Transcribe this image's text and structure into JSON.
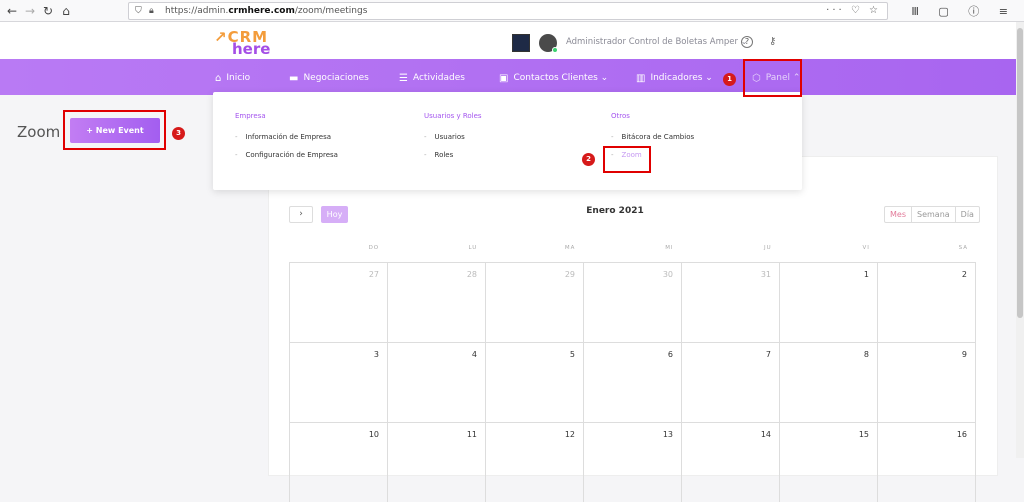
{
  "browser": {
    "url_prefix": "https://admin.",
    "url_domain": "crmhere.com",
    "url_path": "/zoom/meetings",
    "back_glyph": "←",
    "forward_glyph": "→",
    "reload_glyph": "↻",
    "home_glyph": "⌂",
    "url_right_glyphs": "··· ♡ ☆",
    "toolbar_glyphs": "Ⅲ ▢ ⓘ ≡"
  },
  "brand": {
    "logo_line1": "↗CRM",
    "logo_line2": "here",
    "orange": "#f39c3b",
    "purple": "#a44ee6"
  },
  "header": {
    "username": "Administrador Control de Boletas Amper ⌄",
    "help_glyph": "?",
    "key_glyph": "⚷"
  },
  "nav": {
    "items": [
      {
        "label": "Inicio",
        "icon": "⌂"
      },
      {
        "label": "Negociaciones",
        "icon": "▬"
      },
      {
        "label": "Actividades",
        "icon": "☰"
      },
      {
        "label": "Contactos Clientes ⌄",
        "icon": "▣"
      },
      {
        "label": "Indicadores ⌄",
        "icon": "▥"
      },
      {
        "label": "Panel ⌃",
        "icon": "⬡"
      }
    ],
    "accent": "#b07af4"
  },
  "dropdown": {
    "columns": [
      {
        "heading": "Empresa",
        "items": [
          "Información de Empresa",
          "Configuración de Empresa"
        ]
      },
      {
        "heading": "Usuarios y Roles",
        "items": [
          "Usuarios",
          "Roles"
        ]
      },
      {
        "heading": "Otros",
        "items": [
          "Bitácora de Cambios",
          "Zoom"
        ]
      }
    ],
    "bullet": "-"
  },
  "page": {
    "title": "Zoom",
    "new_event_label": "+ New Event"
  },
  "calendar": {
    "next_glyph": "›",
    "today_label": "Hoy",
    "month_title": "Enero 2021",
    "views": [
      "Mes",
      "Semana",
      "Día"
    ],
    "weekdays": [
      "DO",
      "LU",
      "MA",
      "MI",
      "JU",
      "VI",
      "SA"
    ],
    "weeks": [
      [
        "27",
        "28",
        "29",
        "30",
        "31",
        "1",
        "2"
      ],
      [
        "3",
        "4",
        "5",
        "6",
        "7",
        "8",
        "9"
      ],
      [
        "10",
        "11",
        "12",
        "13",
        "14",
        "15",
        "16"
      ]
    ]
  },
  "annotations": {
    "markers": [
      "1",
      "2",
      "3"
    ],
    "color": "#e00000"
  }
}
